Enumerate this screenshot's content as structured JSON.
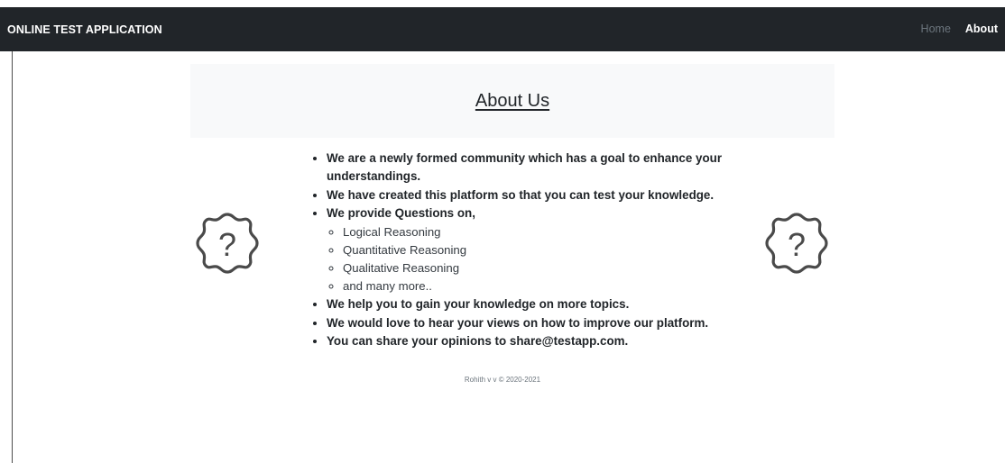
{
  "navbar": {
    "brand": "ONLINE TEST APPLICATION",
    "links": [
      {
        "label": "Home",
        "active": false
      },
      {
        "label": "About",
        "active": true
      }
    ],
    "background": "#212529"
  },
  "hero": {
    "title": "About Us",
    "background": "#f8f9fa"
  },
  "about_points": {
    "p1": "We are a newly formed community which has a goal to enhance your understandings.",
    "p2": "We have created this platform so that you can test your knowledge.",
    "p3": "We provide Questions on,",
    "topics": [
      "Logical Reasoning",
      "Quantitative Reasoning",
      "Qualitative Reasoning",
      "and many more.."
    ],
    "p4": "We help you to gain your knowledge on more topics.",
    "p5": "We would love to hear your views on how to improve our platform.",
    "p6": "You can share your opinions to share@testapp.com."
  },
  "icons": {
    "left": "question-badge-icon",
    "right": "question-badge-icon"
  },
  "footer": {
    "text": "Rohith v v © 2020-2021"
  }
}
